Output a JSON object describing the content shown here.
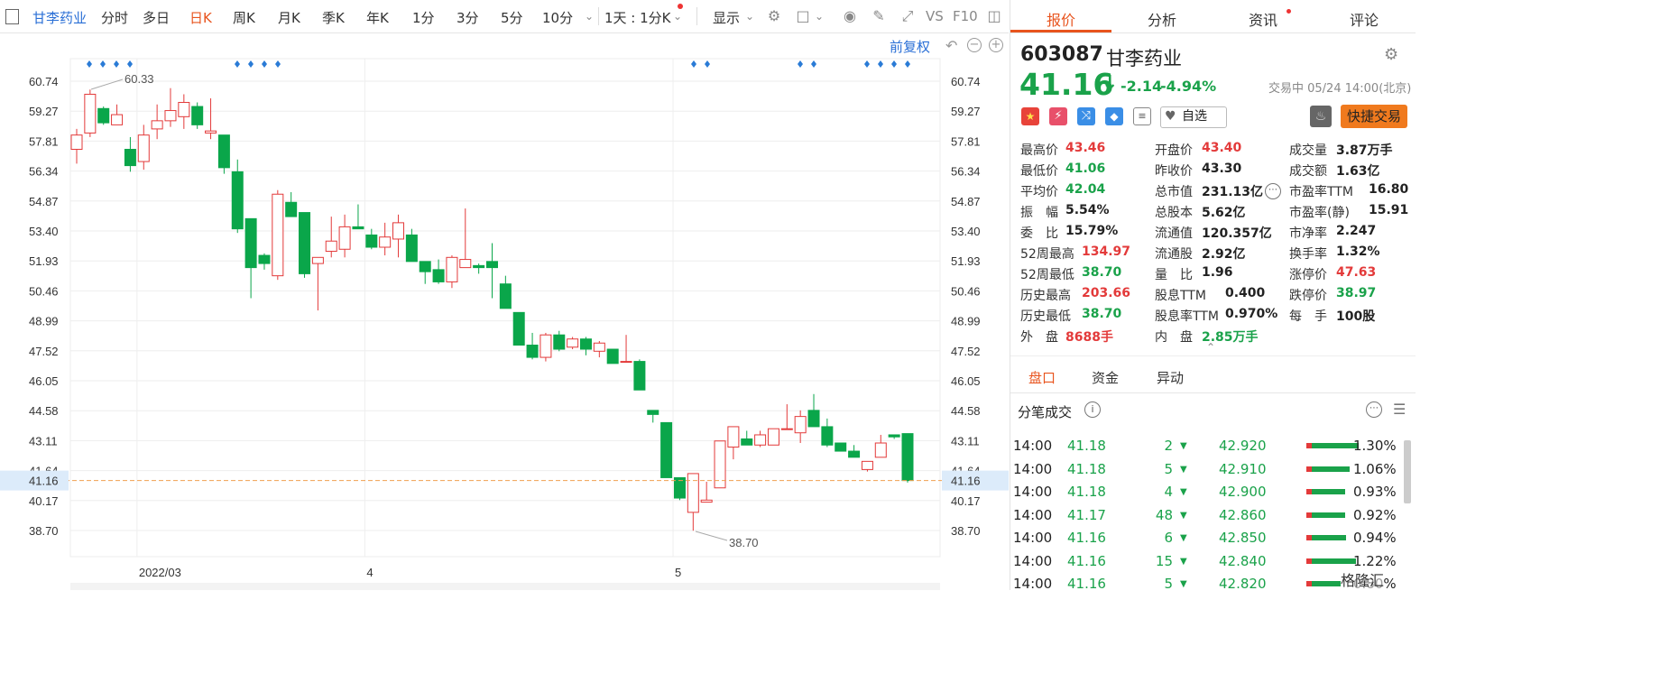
{
  "toolbar": {
    "stock_name": "甘李药业",
    "periods": [
      "分时",
      "多日",
      "日K",
      "周K",
      "月K",
      "季K",
      "年K",
      "1分",
      "3分",
      "5分",
      "10分"
    ],
    "active_period": "日K",
    "range_selector": "1天 : 1分K",
    "display_label": "显示",
    "vs_label": "VS",
    "f10_label": "F10"
  },
  "chart": {
    "adjust_label": "前复权",
    "y_ticks": [
      "60.74",
      "59.27",
      "57.81",
      "56.34",
      "54.87",
      "53.40",
      "51.93",
      "50.46",
      "48.99",
      "47.52",
      "46.05",
      "44.58",
      "43.11",
      "41.64",
      "40.17",
      "38.70"
    ],
    "current_price_tag": "41.16",
    "high_annotation": "60.33",
    "low_annotation": "38.70",
    "x_labels": [
      "2022/03",
      "4",
      "5"
    ],
    "colors": {
      "up": "#e33a3a",
      "down": "#0aa64a",
      "current": "#f0a050",
      "grid": "#eeeeee"
    }
  },
  "chart_data": {
    "type": "candlestick",
    "ylim": [
      38.0,
      61.5
    ],
    "ohlc": [
      [
        57.4,
        58.4,
        56.7,
        58.1
      ],
      [
        58.2,
        60.33,
        58.0,
        60.1
      ],
      [
        59.4,
        59.5,
        58.6,
        58.7
      ],
      [
        58.6,
        59.6,
        58.6,
        59.1
      ],
      [
        57.4,
        58.0,
        56.3,
        56.6
      ],
      [
        56.8,
        58.6,
        56.4,
        58.1
      ],
      [
        58.4,
        59.6,
        57.9,
        58.8
      ],
      [
        58.8,
        60.4,
        58.5,
        59.3
      ],
      [
        59.0,
        60.1,
        58.4,
        59.7
      ],
      [
        59.5,
        59.7,
        58.4,
        58.6
      ],
      [
        58.2,
        59.9,
        57.9,
        58.3
      ],
      [
        58.1,
        58.1,
        56.2,
        56.5
      ],
      [
        56.3,
        56.9,
        53.3,
        53.5
      ],
      [
        54.0,
        54.0,
        50.1,
        51.6
      ],
      [
        52.2,
        52.3,
        51.5,
        51.8
      ],
      [
        51.2,
        55.4,
        51.0,
        55.2
      ],
      [
        54.8,
        55.3,
        54.1,
        54.1
      ],
      [
        54.3,
        54.3,
        51.1,
        51.3
      ],
      [
        51.8,
        52.1,
        49.5,
        52.1
      ],
      [
        52.4,
        54.1,
        52.1,
        52.9
      ],
      [
        52.5,
        54.2,
        52.1,
        53.6
      ],
      [
        53.6,
        54.7,
        53.5,
        53.5
      ],
      [
        53.2,
        53.5,
        52.5,
        52.6
      ],
      [
        52.6,
        53.8,
        52.2,
        53.1
      ],
      [
        53.0,
        54.2,
        52.1,
        53.8
      ],
      [
        53.2,
        53.5,
        51.9,
        51.9
      ],
      [
        51.9,
        51.9,
        50.8,
        51.4
      ],
      [
        51.5,
        52.0,
        50.8,
        50.9
      ],
      [
        50.9,
        52.2,
        50.6,
        52.1
      ],
      [
        51.6,
        54.5,
        51.6,
        52.0
      ],
      [
        51.7,
        51.8,
        51.3,
        51.6
      ],
      [
        51.9,
        52.8,
        50.1,
        51.6
      ],
      [
        50.8,
        51.2,
        49.6,
        49.6
      ],
      [
        49.4,
        49.4,
        47.8,
        47.8
      ],
      [
        47.8,
        48.4,
        47.1,
        47.2
      ],
      [
        47.2,
        48.4,
        47.0,
        48.3
      ],
      [
        48.3,
        48.5,
        47.5,
        47.6
      ],
      [
        47.7,
        48.2,
        47.6,
        48.1
      ],
      [
        48.1,
        48.2,
        47.3,
        47.6
      ],
      [
        47.5,
        48.0,
        47.2,
        47.9
      ],
      [
        47.6,
        47.6,
        46.9,
        46.9
      ],
      [
        47.0,
        48.3,
        47.0,
        47.0
      ],
      [
        47.0,
        47.1,
        45.6,
        45.6
      ],
      [
        44.6,
        44.6,
        44.0,
        44.4
      ],
      [
        44.0,
        44.0,
        41.3,
        41.3
      ],
      [
        41.3,
        41.3,
        40.2,
        40.3
      ],
      [
        39.6,
        41.5,
        38.7,
        41.5
      ],
      [
        40.1,
        41.1,
        40.1,
        40.2
      ],
      [
        40.8,
        43.1,
        40.8,
        43.1
      ],
      [
        42.8,
        43.8,
        42.2,
        43.8
      ],
      [
        43.2,
        43.6,
        42.9,
        42.9
      ],
      [
        42.9,
        43.6,
        42.8,
        43.4
      ],
      [
        42.9,
        43.7,
        42.9,
        43.7
      ],
      [
        43.7,
        44.9,
        43.7,
        43.7
      ],
      [
        43.5,
        44.6,
        43.0,
        44.3
      ],
      [
        44.6,
        45.4,
        43.8,
        43.8
      ],
      [
        43.8,
        44.2,
        42.8,
        42.9
      ],
      [
        43.0,
        43.0,
        42.6,
        42.6
      ],
      [
        42.6,
        42.9,
        42.3,
        42.3
      ],
      [
        41.7,
        42.1,
        41.6,
        42.1
      ],
      [
        42.3,
        43.4,
        42.3,
        43.0
      ],
      [
        43.4,
        43.4,
        43.2,
        43.3
      ],
      [
        43.46,
        43.46,
        41.06,
        41.16
      ]
    ]
  },
  "quote": {
    "code": "603087",
    "name": "甘李药业",
    "price": "41.16",
    "change": "-2.14",
    "change_pct": "-4.94%",
    "status": "交易中 05/24 14:00(北京)",
    "watch_label": "自选",
    "fast_trade_label": "快捷交易",
    "fields": [
      {
        "label": "最高价",
        "value": "43.46",
        "color": "red"
      },
      {
        "label": "开盘价",
        "value": "43.40",
        "color": "red"
      },
      {
        "label": "成交量",
        "value": "3.87万手",
        "color": "dark"
      },
      {
        "label": "最低价",
        "value": "41.06",
        "color": "green"
      },
      {
        "label": "昨收价",
        "value": "43.30",
        "color": "dark"
      },
      {
        "label": "成交额",
        "value": "1.63亿",
        "color": "dark"
      },
      {
        "label": "平均价",
        "value": "42.04",
        "color": "green"
      },
      {
        "label": "总市值",
        "value": "231.13亿",
        "color": "dark"
      },
      {
        "label": "市盈率TTM",
        "value": "16.80",
        "color": "dark"
      },
      {
        "label": "振　幅",
        "value": "5.54%",
        "color": "dark"
      },
      {
        "label": "总股本",
        "value": "5.62亿",
        "color": "dark"
      },
      {
        "label": "市盈率(静)",
        "value": "15.91",
        "color": "dark"
      },
      {
        "label": "委　比",
        "value": "15.79%",
        "color": "dark"
      },
      {
        "label": "流通值",
        "value": "120.357亿",
        "color": "dark"
      },
      {
        "label": "市净率",
        "value": "2.247",
        "color": "dark"
      },
      {
        "label": "52周最高",
        "value": "134.97",
        "color": "red"
      },
      {
        "label": "流通股",
        "value": "2.92亿",
        "color": "dark"
      },
      {
        "label": "换手率",
        "value": "1.32%",
        "color": "dark"
      },
      {
        "label": "52周最低",
        "value": "38.70",
        "color": "green"
      },
      {
        "label": "量　比",
        "value": "1.96",
        "color": "dark"
      },
      {
        "label": "涨停价",
        "value": "47.63",
        "color": "red"
      },
      {
        "label": "历史最高",
        "value": "203.66",
        "color": "red"
      },
      {
        "label": "股息TTM",
        "value": "0.400",
        "color": "dark"
      },
      {
        "label": "跌停价",
        "value": "38.97",
        "color": "green"
      },
      {
        "label": "历史最低",
        "value": "38.70",
        "color": "green"
      },
      {
        "label": "股息率TTM",
        "value": "0.970%",
        "color": "dark"
      },
      {
        "label": "每　手",
        "value": "100股",
        "color": "dark"
      },
      {
        "label": "外　盘",
        "value": "8688手",
        "color": "red"
      },
      {
        "label": "内　盘",
        "value": "2.85万手",
        "color": "green"
      }
    ]
  },
  "right_tabs": [
    "报价",
    "分析",
    "资讯",
    "评论"
  ],
  "sub_tabs": [
    "盘口",
    "资金",
    "异动"
  ],
  "ticks": {
    "title": "分笔成交",
    "rows": [
      {
        "time": "14:00",
        "price": "41.18",
        "vol": "2"
      },
      {
        "time": "14:00",
        "price": "41.18",
        "vol": "5"
      },
      {
        "time": "14:00",
        "price": "41.18",
        "vol": "4"
      },
      {
        "time": "14:00",
        "price": "41.17",
        "vol": "48"
      },
      {
        "time": "14:00",
        "price": "41.16",
        "vol": "6"
      },
      {
        "time": "14:00",
        "price": "41.16",
        "vol": "15"
      },
      {
        "time": "14:00",
        "price": "41.16",
        "vol": "5"
      }
    ],
    "price_dist": [
      {
        "price": "42.920",
        "pct": "1.30%",
        "pct_value": 1.3
      },
      {
        "price": "42.910",
        "pct": "1.06%",
        "pct_value": 1.06
      },
      {
        "price": "42.900",
        "pct": "0.93%",
        "pct_value": 0.93
      },
      {
        "price": "42.860",
        "pct": "0.92%",
        "pct_value": 0.92
      },
      {
        "price": "42.850",
        "pct": "0.94%",
        "pct_value": 0.94
      },
      {
        "price": "42.840",
        "pct": "1.22%",
        "pct_value": 1.22
      },
      {
        "price": "42.820",
        "pct": "0.80%",
        "pct_value": 0.8
      }
    ],
    "watermark": "格隆汇"
  }
}
